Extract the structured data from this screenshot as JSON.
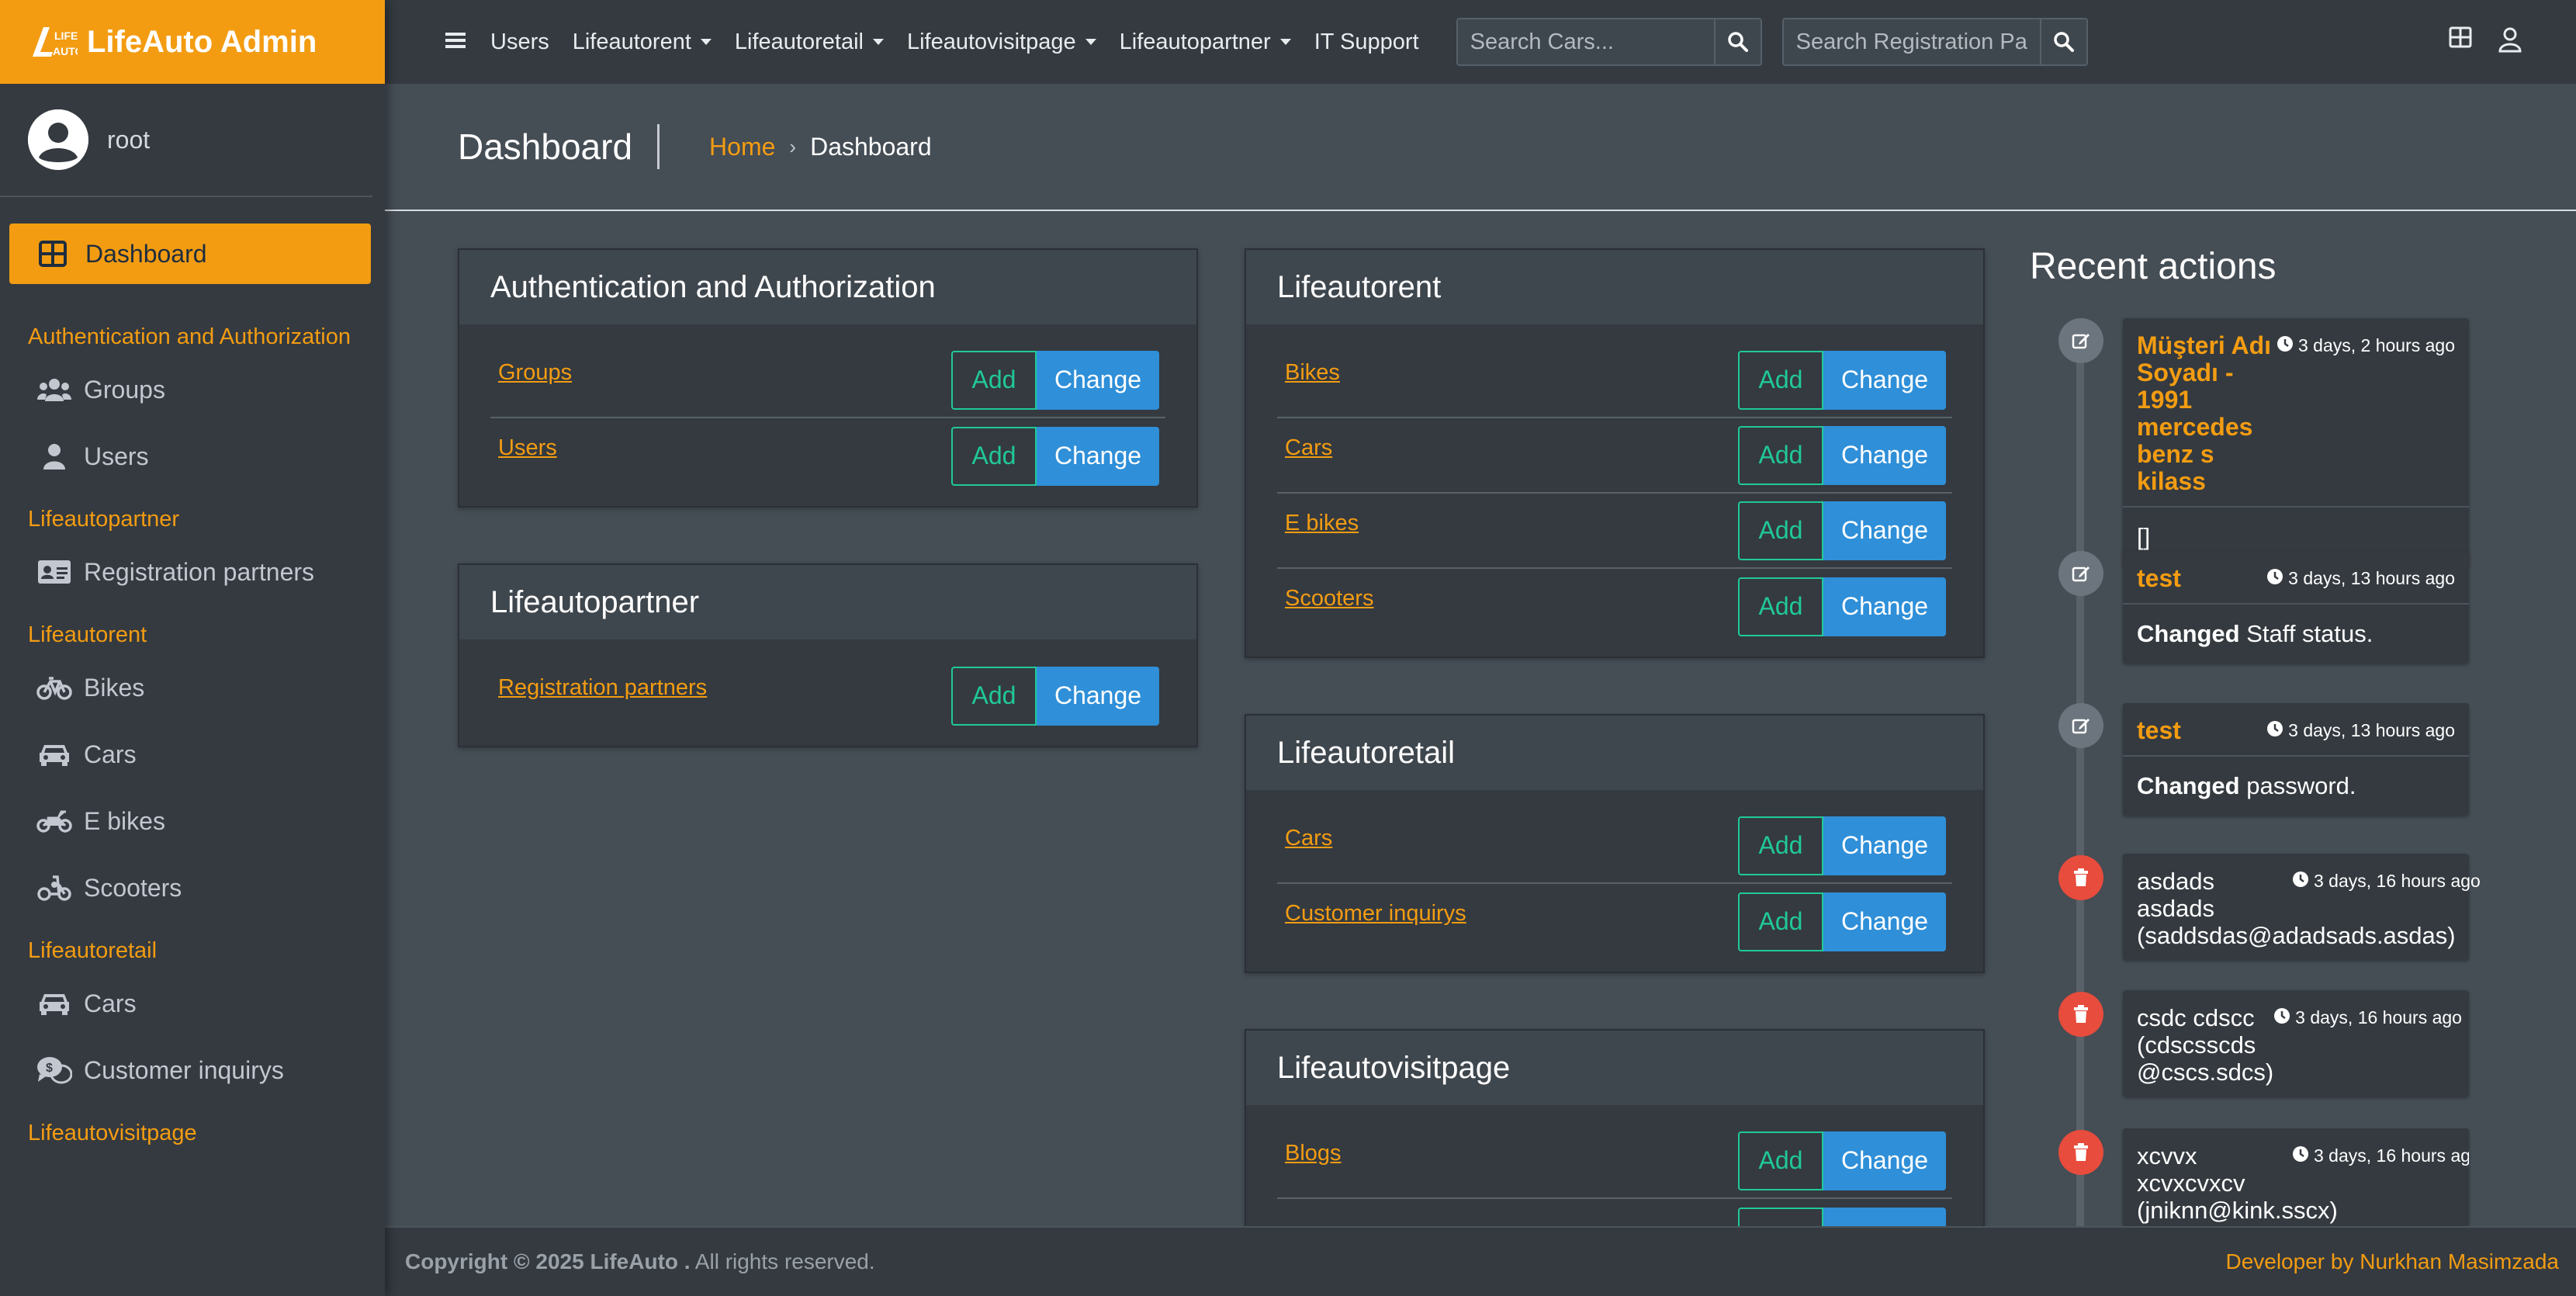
{
  "brand": {
    "name": "LifeAuto Admin",
    "logo_text": "LIFE AUTO"
  },
  "user": {
    "name": "root"
  },
  "sidebar": {
    "active": {
      "label": "Dashboard",
      "icon": "grid-icon"
    },
    "sections": [
      {
        "title": "Authentication and Authorization",
        "items": [
          {
            "label": "Groups",
            "icon": "users-icon"
          },
          {
            "label": "Users",
            "icon": "user-icon"
          }
        ]
      },
      {
        "title": "Lifeautopartner",
        "items": [
          {
            "label": "Registration partners",
            "icon": "id-card-icon"
          }
        ]
      },
      {
        "title": "Lifeautorent",
        "items": [
          {
            "label": "Bikes",
            "icon": "bicycle-icon"
          },
          {
            "label": "Cars",
            "icon": "car-icon"
          },
          {
            "label": "E bikes",
            "icon": "motorcycle-icon"
          },
          {
            "label": "Scooters",
            "icon": "scooter-icon"
          }
        ]
      },
      {
        "title": "Lifeautoretail",
        "items": [
          {
            "label": "Cars",
            "icon": "car-icon"
          },
          {
            "label": "Customer inquirys",
            "icon": "comments-dollar-icon"
          }
        ]
      },
      {
        "title": "Lifeautovisitpage",
        "items": []
      }
    ]
  },
  "topbar": {
    "links": [
      {
        "label": "Users",
        "dropdown": false
      },
      {
        "label": "Lifeautorent",
        "dropdown": true
      },
      {
        "label": "Lifeautoretail",
        "dropdown": true
      },
      {
        "label": "Lifeautovisitpage",
        "dropdown": true
      },
      {
        "label": "Lifeautopartner",
        "dropdown": true
      },
      {
        "label": "IT Support",
        "dropdown": false
      }
    ],
    "search_cars_placeholder": "Search Cars...",
    "search_reg_placeholder": "Search Registration Pa"
  },
  "header": {
    "title": "Dashboard",
    "breadcrumb_home": "Home",
    "breadcrumb_current": "Dashboard"
  },
  "buttons": {
    "add": "Add",
    "change": "Change"
  },
  "modules": {
    "auth": {
      "title": "Authentication and Authorization",
      "rows": [
        "Groups",
        "Users"
      ]
    },
    "partner": {
      "title": "Lifeautopartner",
      "rows": [
        "Registration partners"
      ]
    },
    "rent": {
      "title": "Lifeautorent",
      "rows": [
        "Bikes",
        "Cars",
        "E bikes",
        "Scooters"
      ]
    },
    "retail": {
      "title": "Lifeautoretail",
      "rows": [
        "Cars",
        "Customer inquirys"
      ]
    },
    "visit": {
      "title": "Lifeautovisitpage",
      "rows": [
        "Blogs"
      ]
    }
  },
  "recent": {
    "title": "Recent actions",
    "items": [
      {
        "type": "edit",
        "who": "Müşteri Adı Soyadı - 1991 mercedes benz s kilass",
        "time": "3 days, 2 hours ago",
        "body_bold": "",
        "body": "[]"
      },
      {
        "type": "edit",
        "who": "test",
        "time": "3 days, 13 hours ago",
        "body_bold": "Changed",
        "body": " Staff status."
      },
      {
        "type": "edit",
        "who": "test",
        "time": "3 days, 13 hours ago",
        "body_bold": "Changed",
        "body": " password."
      },
      {
        "type": "delete",
        "who": "asdads asdads (saddsdas@adadsads.asdas)",
        "time": "3 days, 16 hours ago"
      },
      {
        "type": "delete",
        "who": "csdc cdscc (cdscsscds @cscs.sdcs)",
        "time": "3 days, 16 hours ago"
      },
      {
        "type": "delete",
        "who": "xcvvx xcvxcvxcv (jniknn@kink.sscx)",
        "time": "3 days, 16 hours ago"
      }
    ]
  },
  "footer": {
    "copyright_bold": "Copyright © 2025 LifeAuto .",
    "copyright_rest": " All rights reserved.",
    "developer": "Developer by Nurkhan Masimzada"
  },
  "colors": {
    "accent": "#f39c12",
    "sidebar": "#343a40",
    "content": "#454d55",
    "add": "#20c997",
    "change": "#2f8fd8",
    "delete": "#e74c3c",
    "edit": "#6c757d"
  }
}
